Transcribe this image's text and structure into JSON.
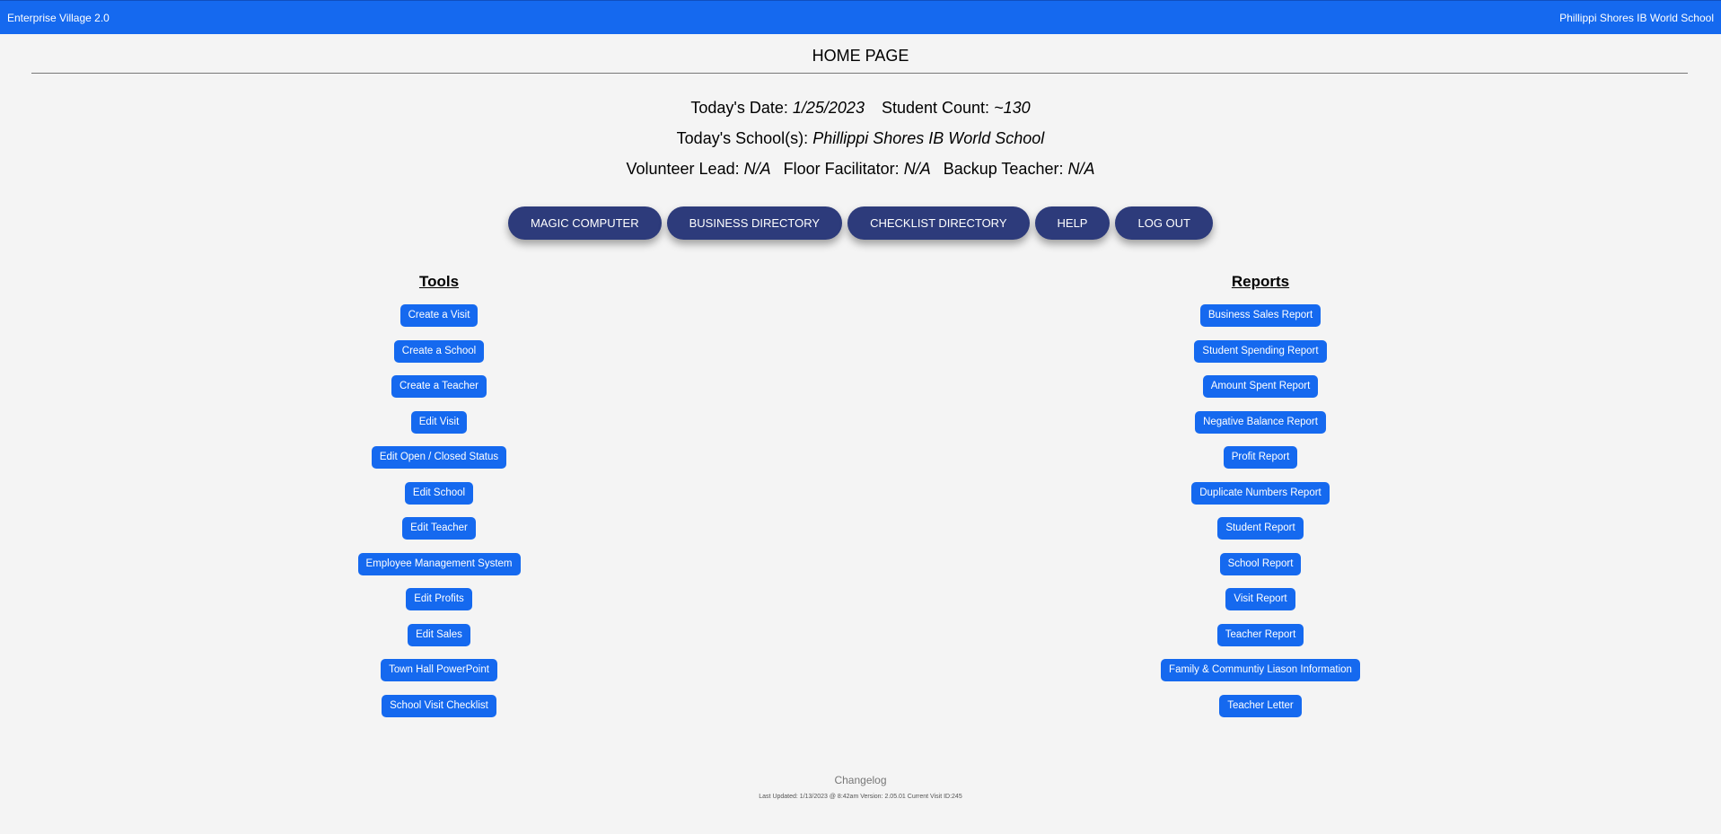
{
  "header": {
    "app_title": "Enterprise Village 2.0",
    "school_name": "Phillippi Shores IB World School"
  },
  "page": {
    "title": "HOME PAGE"
  },
  "info": {
    "date_label": "Today's Date:",
    "date_value": "1/25/2023",
    "student_count_label": "Student Count:",
    "student_count_value": "~130",
    "schools_label": "Today's School(s):",
    "schools_value": "Phillippi Shores IB World School",
    "volunteer_lead_label": "Volunteer Lead:",
    "volunteer_lead_value": "N/A",
    "floor_facilitator_label": "Floor Facilitator:",
    "floor_facilitator_value": "N/A",
    "backup_teacher_label": "Backup Teacher:",
    "backup_teacher_value": "N/A"
  },
  "nav": {
    "magic_computer": "MAGIC COMPUTER",
    "business_directory": "BUSINESS DIRECTORY",
    "checklist_directory": "CHECKLIST DIRECTORY",
    "help": "HELP",
    "log_out": "LOG OUT"
  },
  "tools": {
    "heading": "Tools",
    "items": [
      {
        "label": "Create a Visit"
      },
      {
        "label": "Create a School"
      },
      {
        "label": "Create a Teacher"
      },
      {
        "label": "Edit Visit"
      },
      {
        "label": "Edit Open / Closed Status"
      },
      {
        "label": "Edit School"
      },
      {
        "label": "Edit Teacher"
      },
      {
        "label": "Employee Management System"
      },
      {
        "label": "Edit Profits"
      },
      {
        "label": "Edit Sales"
      },
      {
        "label": "Town Hall PowerPoint"
      },
      {
        "label": "School Visit Checklist"
      }
    ]
  },
  "reports": {
    "heading": "Reports",
    "items": [
      {
        "label": "Business Sales Report"
      },
      {
        "label": "Student Spending Report"
      },
      {
        "label": "Amount Spent Report"
      },
      {
        "label": "Negative Balance Report"
      },
      {
        "label": "Profit Report"
      },
      {
        "label": "Duplicate Numbers Report"
      },
      {
        "label": "Student Report"
      },
      {
        "label": "School Report"
      },
      {
        "label": "Visit Report"
      },
      {
        "label": "Teacher Report"
      },
      {
        "label": "Family & Communtiy Liason Information"
      },
      {
        "label": "Teacher Letter"
      }
    ]
  },
  "footer": {
    "changelog": "Changelog",
    "meta": "Last Updated: 1/13/2023 @ 8:42am  Version: 2.05.01  Current Visit ID:245"
  }
}
